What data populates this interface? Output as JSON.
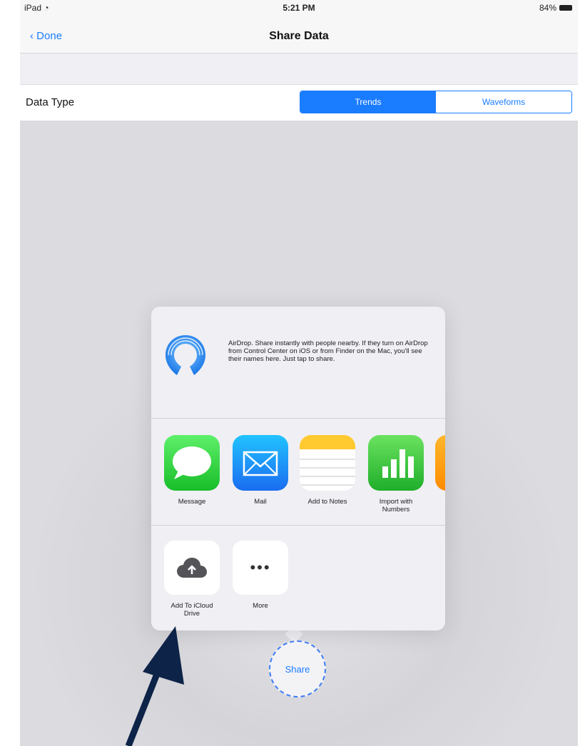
{
  "status_bar": {
    "device": "iPad",
    "time": "5:21 PM",
    "battery": "84%"
  },
  "nav": {
    "back_label": "Done",
    "title": "Share Data"
  },
  "data_type": {
    "label": "Data Type",
    "segments": [
      "Trends",
      "Waveforms"
    ],
    "selected": "Trends"
  },
  "share_sheet": {
    "airdrop_text": "AirDrop. Share instantly with people nearby. If they turn on AirDrop from Control Center on iOS or from Finder on the Mac, you'll see their names here. Just tap to share.",
    "apps": [
      {
        "label": "Message",
        "icon": "message-icon"
      },
      {
        "label": "Mail",
        "icon": "mail-icon"
      },
      {
        "label": "Add to Notes",
        "icon": "notes-icon"
      },
      {
        "label": "Import with Numbers",
        "icon": "numbers-icon"
      }
    ],
    "actions": [
      {
        "label": "Add To iCloud Drive",
        "icon": "icloud-upload-icon"
      },
      {
        "label": "More",
        "icon": "more-icon"
      }
    ]
  },
  "share_button": {
    "label": "Share"
  },
  "colors": {
    "accent": "#1a7cff",
    "annotation_arrow": "#0d2347"
  }
}
